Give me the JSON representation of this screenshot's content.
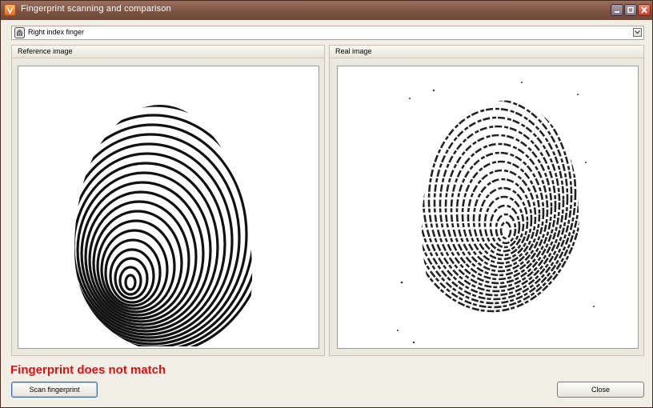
{
  "window": {
    "title": "Fingerprint scanning and comparison"
  },
  "finger_select": {
    "value": "Right index finger"
  },
  "panels": {
    "reference": {
      "title": "Reference image"
    },
    "real": {
      "title": "Real image"
    }
  },
  "status": {
    "text": "Fingerprint does not match",
    "color": "#e01010"
  },
  "buttons": {
    "scan": "Scan fingerprint",
    "close": "Close"
  },
  "icons": {
    "app": "app-icon",
    "finger": "fingerprint-icon",
    "dropdown": "chevron-down-icon"
  }
}
